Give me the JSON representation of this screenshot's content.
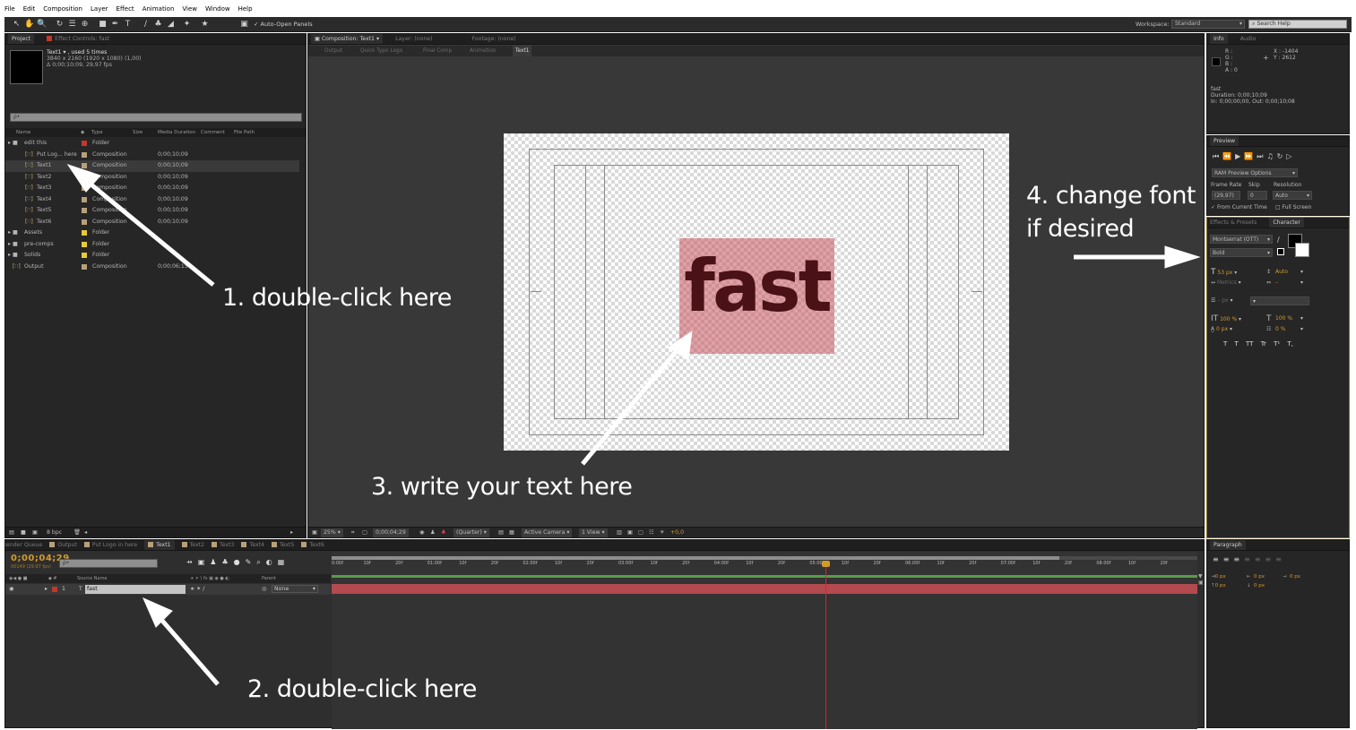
{
  "menu": [
    "File",
    "Edit",
    "Composition",
    "Layer",
    "Effect",
    "Animation",
    "View",
    "Window",
    "Help"
  ],
  "toolbar": {
    "auto_open_label": "Auto-Open Panels",
    "workspace_label": "Workspace:",
    "workspace_value": "Standard",
    "search_placeholder": "Search Help"
  },
  "project_panel": {
    "tabs": [
      "Project",
      "Effect Controls: fast"
    ],
    "info_name": "Text1 ▾ , used 5 times",
    "info_size": "3840 x 2160  (1920 x 1080) (1,00)",
    "info_duration": "Δ 0;00;10;09, 29,97 fps",
    "search_placeholder": "ρ•",
    "columns": [
      "Name",
      "Type",
      "Size",
      "Media Duration",
      "Comment",
      "File Path"
    ],
    "items": [
      {
        "name": "edit this",
        "type": "Folder",
        "duration": "",
        "color": "#c0392b",
        "kind": "folder",
        "indent": 0
      },
      {
        "name": "Put Log... here",
        "type": "Composition",
        "duration": "0;00;10;09",
        "color": "#b8a07a",
        "kind": "comp",
        "indent": 1
      },
      {
        "name": "Text1",
        "type": "Composition",
        "duration": "0;00;10;09",
        "color": "#b8a07a",
        "kind": "comp",
        "indent": 1
      },
      {
        "name": "Text2",
        "type": "Composition",
        "duration": "0;00;10;09",
        "color": "#b8a07a",
        "kind": "comp",
        "indent": 1
      },
      {
        "name": "Text3",
        "type": "Composition",
        "duration": "0;00;10;09",
        "color": "#b8a07a",
        "kind": "comp",
        "indent": 1
      },
      {
        "name": "Text4",
        "type": "Composition",
        "duration": "0;00;10;09",
        "color": "#b8a07a",
        "kind": "comp",
        "indent": 1
      },
      {
        "name": "Text5",
        "type": "Composition",
        "duration": "0;00;10;09",
        "color": "#b8a07a",
        "kind": "comp",
        "indent": 1
      },
      {
        "name": "Text6",
        "type": "Composition",
        "duration": "0;00;10;09",
        "color": "#b8a07a",
        "kind": "comp",
        "indent": 1
      },
      {
        "name": "Assets",
        "type": "Folder",
        "duration": "",
        "color": "#e8c93a",
        "kind": "folder",
        "indent": 0
      },
      {
        "name": "pre-comps",
        "type": "Folder",
        "duration": "",
        "color": "#e8c93a",
        "kind": "folder",
        "indent": 0
      },
      {
        "name": "Solids",
        "type": "Folder",
        "duration": "",
        "color": "#e8c93a",
        "kind": "folder",
        "indent": 0
      },
      {
        "name": "Output",
        "type": "Composition",
        "duration": "0;00;06;15",
        "color": "#b8a07a",
        "kind": "comp",
        "indent": 0
      }
    ],
    "bpc": "8 bpc"
  },
  "comp_panel": {
    "tabs": [
      "Composition: Text1",
      "Layer: (none)",
      "Footage: (none)"
    ],
    "breadcrumbs": [
      "Output",
      "Quick Typo Logo",
      "Final Comp",
      "Animation",
      "Text1"
    ],
    "canvas_text": "fast",
    "zoom": "25%",
    "timecode": "0;00;04;29",
    "resolution": "(Quarter)",
    "camera": "Active Camera",
    "views": "1 View",
    "exposure": "+0,0"
  },
  "info_panel": {
    "tabs": [
      "Info",
      "Audio"
    ],
    "r": "R :",
    "g": "G :",
    "b": "B :",
    "a": "A : 0",
    "x": "X : -1404",
    "y": "Y : 2612",
    "name": "fast",
    "duration": "Duration: 0;00;10;09",
    "inout": "In: 0;00;00;00, Out: 0;00;10;08"
  },
  "preview_panel": {
    "tab": "Preview",
    "ram": "RAM Preview Options",
    "frame_rate_label": "Frame Rate",
    "skip_label": "Skip",
    "resolution_label": "Resolution",
    "frame_rate": "(29,97)",
    "skip": "0",
    "resolution": "Auto",
    "from_current": "From Current Time",
    "full_screen": "Full Screen"
  },
  "character_panel": {
    "tabs": [
      "Effects & Presets",
      "Character"
    ],
    "font": "Montserrat (OTT)",
    "style": "Bold",
    "size": "53 px",
    "leading": "Auto",
    "kerning": "Metrics",
    "tracking": "–",
    "stroke": "– px",
    "vscale": "100 %",
    "hscale": "100 %",
    "baseline": "0 px",
    "tsume": "0 %",
    "styles": [
      "T",
      "T",
      "TT",
      "Tr",
      "T¹",
      "T,"
    ]
  },
  "timeline": {
    "tabs": [
      "Render Queue",
      "Output",
      "Put Logo in here",
      "Text1",
      "Text2",
      "Text3",
      "Text4",
      "Text5",
      "Text6"
    ],
    "timecode": "0;00;04;29",
    "fps": "00149 (29.97 fps)",
    "search_placeholder": "ρ•",
    "source_name_label": "Source Name",
    "parent_label": "Parent",
    "layer_number": "1",
    "layer_name": "fast",
    "parent_value": "None",
    "ruler": [
      "0:00f",
      "10f",
      "20f",
      "01:00f",
      "10f",
      "20f",
      "02:00f",
      "10f",
      "20f",
      "03:00f",
      "10f",
      "20f",
      "04:00f",
      "10f",
      "20f",
      "05:00f",
      "10f",
      "20f",
      "06:00f",
      "10f",
      "20f",
      "07:00f",
      "10f",
      "20f",
      "08:00f",
      "10f",
      "20f"
    ]
  },
  "paragraph_panel": {
    "tab": "Paragraph",
    "indent_left": "0 px",
    "indent_right": "0 px",
    "indent_first": "0 px",
    "space_before": "0 px",
    "space_after": "0 px"
  },
  "annotations": {
    "step1": "1. double-click here",
    "step2": "2. double-click here",
    "step3": "3. write your text here",
    "step4_line1": "4. change font",
    "step4_line2": "if desired"
  },
  "colors": {
    "panel_bg": "#262626",
    "accent_orange": "#d39a2a",
    "layer_bar": "#b24a4f",
    "text_highlight": "#d48a8e",
    "text_fill": "#4a1216"
  }
}
